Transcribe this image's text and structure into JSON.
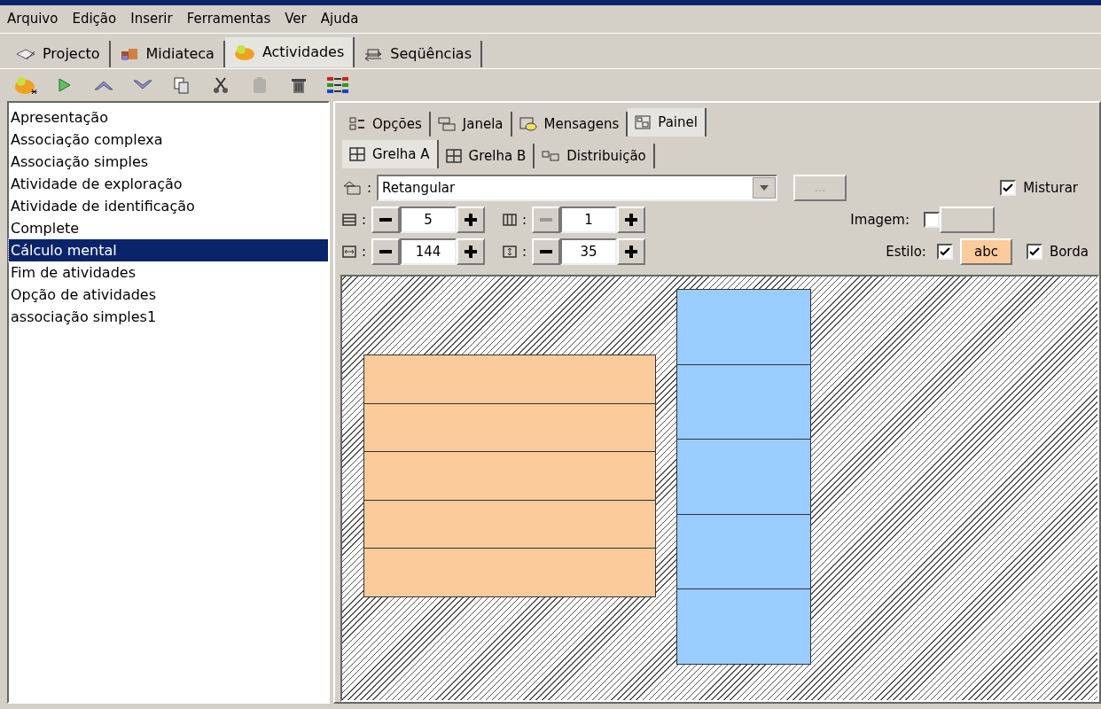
{
  "menu": [
    "Arquivo",
    "Edição",
    "Inserir",
    "Ferramentas",
    "Ver",
    "Ajuda"
  ],
  "main_tabs": [
    {
      "kind": "project",
      "label": "Projecto",
      "selected": false
    },
    {
      "kind": "media",
      "label": "Midiateca",
      "selected": false
    },
    {
      "kind": "activities",
      "label": "Actividades",
      "selected": true
    },
    {
      "kind": "sequences",
      "label": "Seqüências",
      "selected": false
    }
  ],
  "toolbar": [
    {
      "kind": "new",
      "disabled": false
    },
    {
      "kind": "play",
      "disabled": false
    },
    {
      "kind": "up",
      "disabled": false
    },
    {
      "kind": "down",
      "disabled": false
    },
    {
      "kind": "copy",
      "disabled": false
    },
    {
      "kind": "cut",
      "disabled": false
    },
    {
      "kind": "paste",
      "disabled": true
    },
    {
      "kind": "delete",
      "disabled": false
    },
    {
      "kind": "sort",
      "disabled": false
    }
  ],
  "activities": [
    {
      "label": "Apresentação",
      "selected": false
    },
    {
      "label": "Associação complexa",
      "selected": false
    },
    {
      "label": "Associação simples",
      "selected": false
    },
    {
      "label": "Atividade de exploração",
      "selected": false
    },
    {
      "label": "Atividade de identificação",
      "selected": false
    },
    {
      "label": "Complete",
      "selected": false
    },
    {
      "label": "Cálculo mental",
      "selected": true
    },
    {
      "label": "Fim de atividades",
      "selected": false
    },
    {
      "label": "Opção de atividades",
      "selected": false
    },
    {
      "label": "associação simples1",
      "selected": false
    }
  ],
  "panel_tabs": [
    {
      "kind": "options",
      "label": "Opções",
      "selected": false
    },
    {
      "kind": "window",
      "label": "Janela",
      "selected": false
    },
    {
      "kind": "messages",
      "label": "Mensagens",
      "selected": false
    },
    {
      "kind": "panel",
      "label": "Painel",
      "selected": true
    }
  ],
  "sub_tabs": [
    {
      "kind": "grid",
      "label": "Grelha A",
      "selected": true
    },
    {
      "kind": "grid",
      "label": "Grelha B",
      "selected": false
    },
    {
      "kind": "layout",
      "label": "Distribuição",
      "selected": false
    }
  ],
  "shape": {
    "label": ":",
    "value": "Retangular"
  },
  "browse_button": "...",
  "mix": {
    "label": "Misturar",
    "checked": true
  },
  "spinners": [
    {
      "kind": "rows",
      "label": ":",
      "value": "5",
      "minus_disabled": false
    },
    {
      "kind": "cols",
      "label": ":",
      "value": "1",
      "minus_disabled": true
    },
    {
      "kind": "width",
      "label": ":",
      "value": "144",
      "minus_disabled": false
    },
    {
      "kind": "height",
      "label": ":",
      "value": "35",
      "minus_disabled": false
    }
  ],
  "image": {
    "label": "Imagem:",
    "checked": false
  },
  "style": {
    "label": "Estilo:",
    "checked": true,
    "sample": "abc"
  },
  "border": {
    "label": "Borda",
    "checked": true
  }
}
